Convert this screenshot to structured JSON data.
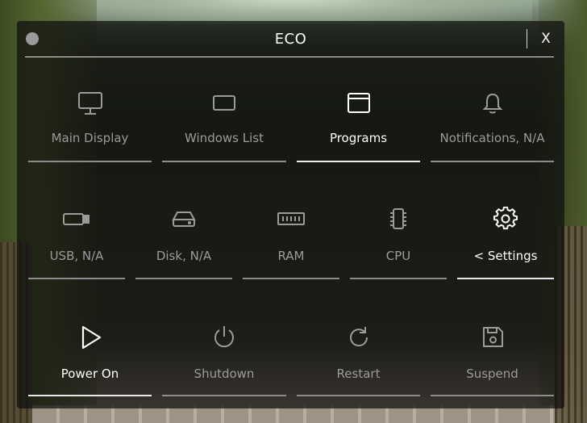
{
  "window": {
    "title": "ECO",
    "close_label": "X"
  },
  "rows": [
    [
      {
        "label": "Main Display",
        "icon": "monitor-icon",
        "active": false
      },
      {
        "label": "Windows List",
        "icon": "window-outline-icon",
        "active": false
      },
      {
        "label": "Programs",
        "icon": "app-window-icon",
        "active": true
      },
      {
        "label": "Notifications, N/A",
        "icon": "bell-icon",
        "active": false
      }
    ],
    [
      {
        "label": "USB, N/A",
        "icon": "usb-drive-icon",
        "active": false
      },
      {
        "label": "Disk, N/A",
        "icon": "hard-disk-icon",
        "active": false
      },
      {
        "label": "RAM",
        "icon": "memory-icon",
        "active": false
      },
      {
        "label": "CPU",
        "icon": "cpu-chip-icon",
        "active": false
      },
      {
        "label": "< Settings",
        "icon": "gear-icon",
        "active": true
      }
    ],
    [
      {
        "label": "Power On",
        "icon": "play-icon",
        "active": true
      },
      {
        "label": "Shutdown",
        "icon": "power-icon",
        "active": false
      },
      {
        "label": "Restart",
        "icon": "restart-icon",
        "active": false
      },
      {
        "label": "Suspend",
        "icon": "save-icon",
        "active": false
      }
    ]
  ],
  "colors": {
    "active_text": "#ffffff",
    "inactive_text": "#9b9b9b",
    "panel_bg": "rgba(14,14,14,0.72)"
  }
}
